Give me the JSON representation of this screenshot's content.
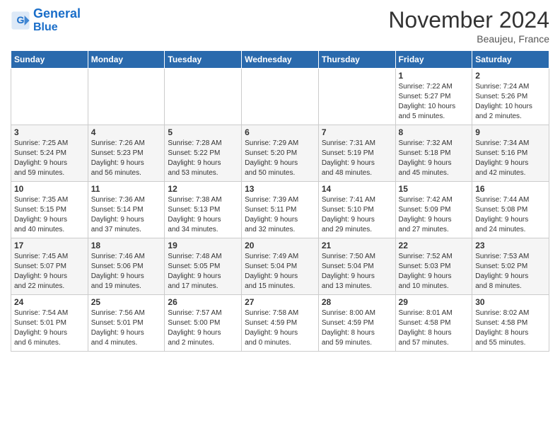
{
  "header": {
    "logo_line1": "General",
    "logo_line2": "Blue",
    "month": "November 2024",
    "location": "Beaujeu, France"
  },
  "weekdays": [
    "Sunday",
    "Monday",
    "Tuesday",
    "Wednesday",
    "Thursday",
    "Friday",
    "Saturday"
  ],
  "weeks": [
    [
      {
        "day": "",
        "info": ""
      },
      {
        "day": "",
        "info": ""
      },
      {
        "day": "",
        "info": ""
      },
      {
        "day": "",
        "info": ""
      },
      {
        "day": "",
        "info": ""
      },
      {
        "day": "1",
        "info": "Sunrise: 7:22 AM\nSunset: 5:27 PM\nDaylight: 10 hours\nand 5 minutes."
      },
      {
        "day": "2",
        "info": "Sunrise: 7:24 AM\nSunset: 5:26 PM\nDaylight: 10 hours\nand 2 minutes."
      }
    ],
    [
      {
        "day": "3",
        "info": "Sunrise: 7:25 AM\nSunset: 5:24 PM\nDaylight: 9 hours\nand 59 minutes."
      },
      {
        "day": "4",
        "info": "Sunrise: 7:26 AM\nSunset: 5:23 PM\nDaylight: 9 hours\nand 56 minutes."
      },
      {
        "day": "5",
        "info": "Sunrise: 7:28 AM\nSunset: 5:22 PM\nDaylight: 9 hours\nand 53 minutes."
      },
      {
        "day": "6",
        "info": "Sunrise: 7:29 AM\nSunset: 5:20 PM\nDaylight: 9 hours\nand 50 minutes."
      },
      {
        "day": "7",
        "info": "Sunrise: 7:31 AM\nSunset: 5:19 PM\nDaylight: 9 hours\nand 48 minutes."
      },
      {
        "day": "8",
        "info": "Sunrise: 7:32 AM\nSunset: 5:18 PM\nDaylight: 9 hours\nand 45 minutes."
      },
      {
        "day": "9",
        "info": "Sunrise: 7:34 AM\nSunset: 5:16 PM\nDaylight: 9 hours\nand 42 minutes."
      }
    ],
    [
      {
        "day": "10",
        "info": "Sunrise: 7:35 AM\nSunset: 5:15 PM\nDaylight: 9 hours\nand 40 minutes."
      },
      {
        "day": "11",
        "info": "Sunrise: 7:36 AM\nSunset: 5:14 PM\nDaylight: 9 hours\nand 37 minutes."
      },
      {
        "day": "12",
        "info": "Sunrise: 7:38 AM\nSunset: 5:13 PM\nDaylight: 9 hours\nand 34 minutes."
      },
      {
        "day": "13",
        "info": "Sunrise: 7:39 AM\nSunset: 5:11 PM\nDaylight: 9 hours\nand 32 minutes."
      },
      {
        "day": "14",
        "info": "Sunrise: 7:41 AM\nSunset: 5:10 PM\nDaylight: 9 hours\nand 29 minutes."
      },
      {
        "day": "15",
        "info": "Sunrise: 7:42 AM\nSunset: 5:09 PM\nDaylight: 9 hours\nand 27 minutes."
      },
      {
        "day": "16",
        "info": "Sunrise: 7:44 AM\nSunset: 5:08 PM\nDaylight: 9 hours\nand 24 minutes."
      }
    ],
    [
      {
        "day": "17",
        "info": "Sunrise: 7:45 AM\nSunset: 5:07 PM\nDaylight: 9 hours\nand 22 minutes."
      },
      {
        "day": "18",
        "info": "Sunrise: 7:46 AM\nSunset: 5:06 PM\nDaylight: 9 hours\nand 19 minutes."
      },
      {
        "day": "19",
        "info": "Sunrise: 7:48 AM\nSunset: 5:05 PM\nDaylight: 9 hours\nand 17 minutes."
      },
      {
        "day": "20",
        "info": "Sunrise: 7:49 AM\nSunset: 5:04 PM\nDaylight: 9 hours\nand 15 minutes."
      },
      {
        "day": "21",
        "info": "Sunrise: 7:50 AM\nSunset: 5:04 PM\nDaylight: 9 hours\nand 13 minutes."
      },
      {
        "day": "22",
        "info": "Sunrise: 7:52 AM\nSunset: 5:03 PM\nDaylight: 9 hours\nand 10 minutes."
      },
      {
        "day": "23",
        "info": "Sunrise: 7:53 AM\nSunset: 5:02 PM\nDaylight: 9 hours\nand 8 minutes."
      }
    ],
    [
      {
        "day": "24",
        "info": "Sunrise: 7:54 AM\nSunset: 5:01 PM\nDaylight: 9 hours\nand 6 minutes."
      },
      {
        "day": "25",
        "info": "Sunrise: 7:56 AM\nSunset: 5:01 PM\nDaylight: 9 hours\nand 4 minutes."
      },
      {
        "day": "26",
        "info": "Sunrise: 7:57 AM\nSunset: 5:00 PM\nDaylight: 9 hours\nand 2 minutes."
      },
      {
        "day": "27",
        "info": "Sunrise: 7:58 AM\nSunset: 4:59 PM\nDaylight: 9 hours\nand 0 minutes."
      },
      {
        "day": "28",
        "info": "Sunrise: 8:00 AM\nSunset: 4:59 PM\nDaylight: 8 hours\nand 59 minutes."
      },
      {
        "day": "29",
        "info": "Sunrise: 8:01 AM\nSunset: 4:58 PM\nDaylight: 8 hours\nand 57 minutes."
      },
      {
        "day": "30",
        "info": "Sunrise: 8:02 AM\nSunset: 4:58 PM\nDaylight: 8 hours\nand 55 minutes."
      }
    ]
  ]
}
